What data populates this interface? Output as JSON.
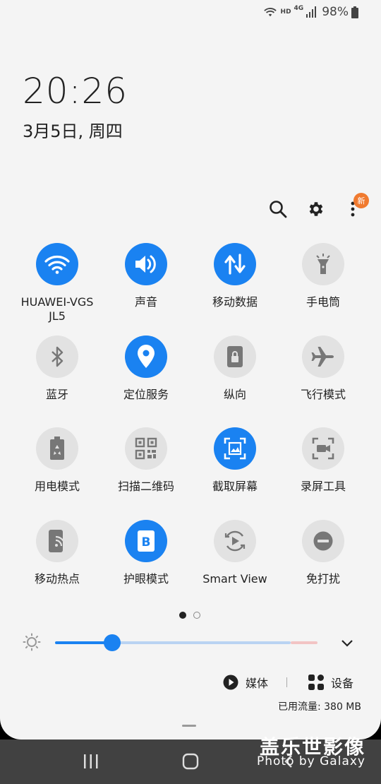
{
  "status_bar": {
    "hd_label": "HD",
    "network_label": "4G",
    "battery_percent": "98%"
  },
  "lock": {
    "time": "20:26",
    "date": "3月5日, 周四"
  },
  "header": {
    "search_icon": "search-icon",
    "settings_icon": "gear-icon",
    "more_icon": "more-vertical-icon",
    "new_badge": "新"
  },
  "tiles": [
    {
      "label": "HUAWEI-VGS JL5",
      "icon": "wifi-icon",
      "active": true
    },
    {
      "label": "声音",
      "icon": "sound-icon",
      "active": true
    },
    {
      "label": "移动数据",
      "icon": "mobile-data-icon",
      "active": true
    },
    {
      "label": "手电筒",
      "icon": "flashlight-icon",
      "active": false
    },
    {
      "label": "蓝牙",
      "icon": "bluetooth-icon",
      "active": false
    },
    {
      "label": "定位服务",
      "icon": "location-icon",
      "active": true
    },
    {
      "label": "纵向",
      "icon": "portrait-lock-icon",
      "active": false
    },
    {
      "label": "飞行模式",
      "icon": "airplane-icon",
      "active": false
    },
    {
      "label": "用电模式",
      "icon": "power-mode-icon",
      "active": false
    },
    {
      "label": "扫描二维码",
      "icon": "qr-code-icon",
      "active": false
    },
    {
      "label": "截取屏幕",
      "icon": "screenshot-icon",
      "active": true
    },
    {
      "label": "录屏工具",
      "icon": "screen-recorder-icon",
      "active": false
    },
    {
      "label": "移动热点",
      "icon": "hotspot-icon",
      "active": false
    },
    {
      "label": "护眼模式",
      "icon": "eye-comfort-icon",
      "active": true
    },
    {
      "label": "Smart View",
      "icon": "smart-view-icon",
      "active": false
    },
    {
      "label": "免打扰",
      "icon": "do-not-disturb-icon",
      "active": false
    }
  ],
  "pagination": {
    "current": 1,
    "total": 2
  },
  "brightness": {
    "level": 0.18
  },
  "media": {
    "media_label": "媒体",
    "devices_label": "设备"
  },
  "data_usage": "已用流量: 380 MB",
  "watermark": {
    "line1": "盖乐世影像",
    "line2": "Photo by Galaxy"
  },
  "colors": {
    "accent": "#1a82f1",
    "panel_bg": "#f4f4f4",
    "tile_off": "#e2e2e2",
    "badge": "#f07a2f"
  }
}
